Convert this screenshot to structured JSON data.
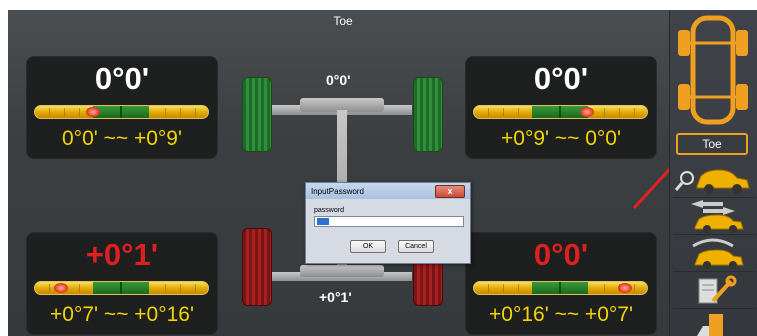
{
  "screen_title": "Toe",
  "panels": {
    "front_left": {
      "value": "0°0'",
      "range": "0°0' ~~ +0°9'"
    },
    "front_right": {
      "value": "0°0'",
      "range": "+0°9' ~~  0°0'"
    },
    "rear_left": {
      "value": "+0°1'",
      "range": "+0°7' ~~ +0°16'"
    },
    "rear_right": {
      "value": "0°0'",
      "range": "+0°16' ~~ +0°7'"
    }
  },
  "car": {
    "front_total": "0°0'",
    "rear_total": "+0°1'"
  },
  "dialog": {
    "title": "InputPassword",
    "close_label": "x",
    "field_label": "password",
    "ok_label": "OK",
    "cancel_label": "Cancel"
  },
  "sidebar": {
    "items": [
      {
        "icon": "car-top-view-icon"
      },
      {
        "label": "Toe"
      },
      {
        "icon": "car-search-icon"
      },
      {
        "icon": "car-swap-icon"
      },
      {
        "icon": "car-gauge-icon"
      },
      {
        "icon": "tools-icon"
      },
      {
        "icon": "lift-icon"
      }
    ]
  },
  "colors": {
    "background": "#3e4244",
    "panel": "#1e1f1f",
    "range_text": "#f2d400",
    "alert_red": "#e02020",
    "accent": "#f0a020"
  }
}
